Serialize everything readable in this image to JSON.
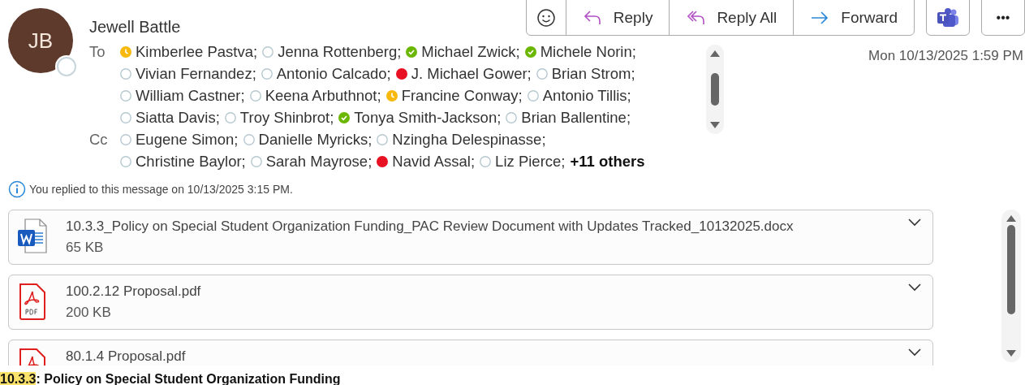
{
  "sender": {
    "initials": "JB",
    "name": "Jewell Battle"
  },
  "toolbar": [
    {
      "kind": "emoji"
    },
    {
      "kind": "reply",
      "label": "Reply"
    },
    {
      "kind": "reply-all",
      "label": "Reply All"
    },
    {
      "kind": "forward",
      "label": "Forward"
    }
  ],
  "extra_buttons": [
    {
      "kind": "teams"
    },
    {
      "kind": "more",
      "label": "•••"
    }
  ],
  "date": "Mon 10/13/2025 1:59 PM",
  "recipient_groups": [
    {
      "label": "To",
      "lines": [
        [
          {
            "name": "Kimberlee Pastva;",
            "kind": "away"
          },
          {
            "name": "Jenna Rottenberg;",
            "kind": "unknown"
          },
          {
            "name": "Michael Zwick;",
            "kind": "available"
          },
          {
            "name": "Michele Norin;",
            "kind": "available"
          }
        ],
        [
          {
            "name": "Vivian Fernandez;",
            "kind": "unknown"
          },
          {
            "name": "Antonio Calcado;",
            "kind": "unknown"
          },
          {
            "name": "J. Michael Gower;",
            "kind": "busy"
          },
          {
            "name": "Brian Strom;",
            "kind": "unknown"
          }
        ],
        [
          {
            "name": "William Castner;",
            "kind": "unknown"
          },
          {
            "name": "Keena Arbuthnot;",
            "kind": "unknown"
          },
          {
            "name": "Francine Conway;",
            "kind": "away"
          },
          {
            "name": "Antonio Tillis;",
            "kind": "unknown"
          }
        ],
        [
          {
            "name": "Siatta Davis;",
            "kind": "unknown"
          },
          {
            "name": "Troy Shinbrot;",
            "kind": "unknown"
          },
          {
            "name": "Tonya Smith-Jackson;",
            "kind": "available"
          },
          {
            "name": "Brian Ballentine;",
            "kind": "unknown"
          }
        ]
      ]
    },
    {
      "label": "Cc",
      "lines": [
        [
          {
            "name": "Eugene Simon;",
            "kind": "unknown"
          },
          {
            "name": "Danielle Myricks;",
            "kind": "unknown"
          },
          {
            "name": "Nzingha Delespinasse;",
            "kind": "unknown"
          }
        ],
        [
          {
            "name": "Christine Baylor;",
            "kind": "unknown"
          },
          {
            "name": "Sarah Mayrose;",
            "kind": "unknown"
          },
          {
            "name": "Navid Assal;",
            "kind": "busy"
          },
          {
            "name": "Liz Pierce;",
            "kind": "unknown"
          }
        ]
      ],
      "more": "+11 others"
    }
  ],
  "info": "You replied to this message on 10/13/2025 3:15 PM.",
  "attachments": [
    {
      "kind": "word",
      "name": "10.3.3_Policy on Special Student Organization Funding_PAC Review Document with Updates Tracked_10132025.docx",
      "size": "65 KB"
    },
    {
      "kind": "pdf",
      "name": "100.2.12 Proposal.pdf",
      "size": "200 KB"
    },
    {
      "kind": "pdf",
      "name": "80.1.4 Proposal.pdf"
    }
  ],
  "body_heading": [
    {
      "text": "10.3.3",
      "highlighted": true
    },
    {
      "text": ": Policy on Special Student Organization Funding",
      "highlighted": false
    }
  ]
}
